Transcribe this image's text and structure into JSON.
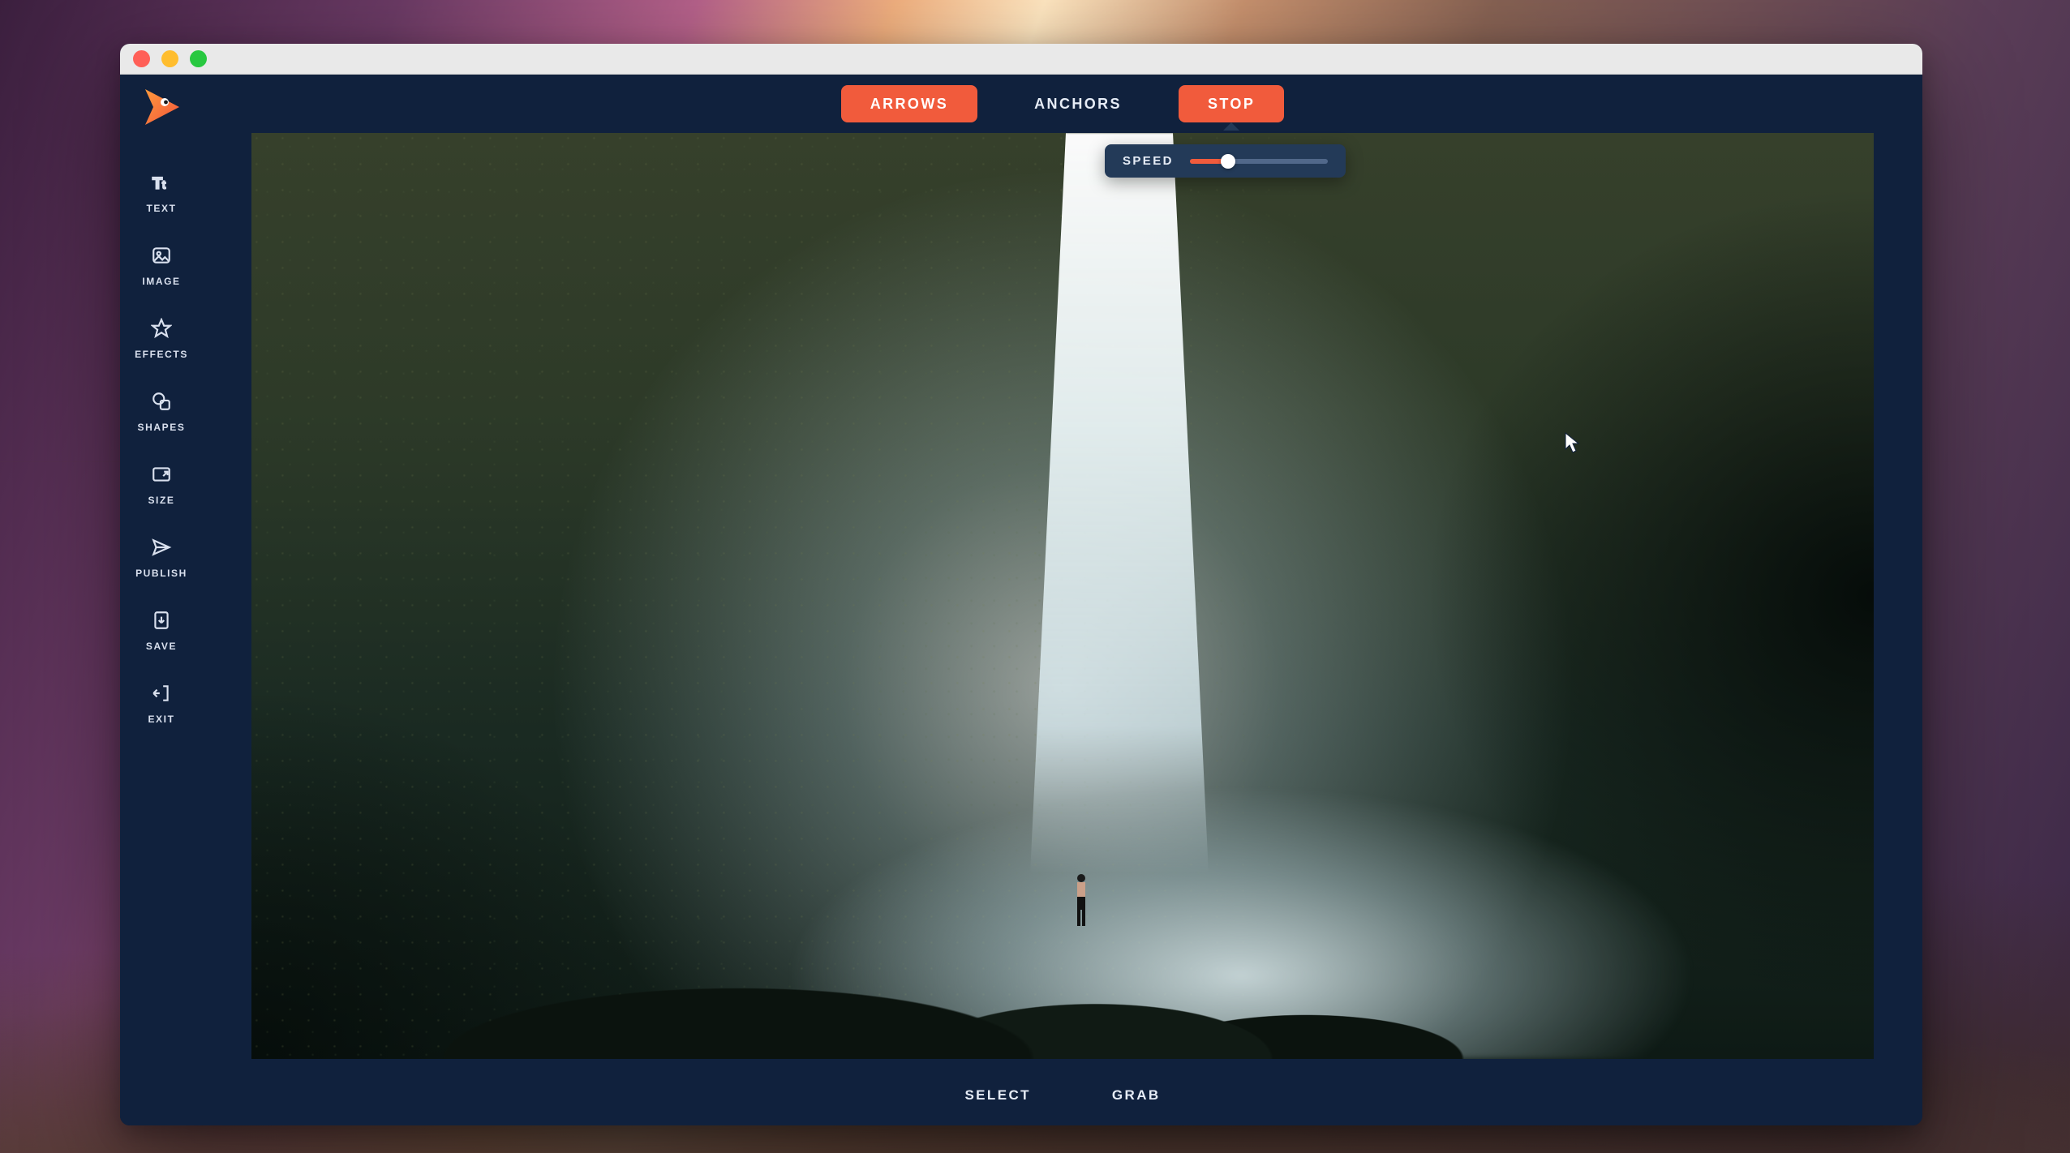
{
  "colors": {
    "accent": "#f15b3c",
    "app_bg": "#10213d",
    "popover_bg": "#233a58",
    "text": "#e6ecf6"
  },
  "sidebar": {
    "items": [
      {
        "id": "text",
        "label": "TEXT"
      },
      {
        "id": "image",
        "label": "IMAGE"
      },
      {
        "id": "effects",
        "label": "EFFECTS"
      },
      {
        "id": "shapes",
        "label": "SHAPES"
      },
      {
        "id": "size",
        "label": "SIZE"
      },
      {
        "id": "publish",
        "label": "PUBLISH"
      },
      {
        "id": "save",
        "label": "SAVE"
      },
      {
        "id": "exit",
        "label": "EXIT"
      }
    ]
  },
  "top_toolbar": {
    "arrows_label": "ARROWS",
    "anchors_label": "ANCHORS",
    "stop_label": "STOP",
    "active": "arrows"
  },
  "speed_control": {
    "label": "SPEED",
    "value_pct": 28
  },
  "bottom_toolbar": {
    "select_label": "SELECT",
    "grab_label": "GRAB"
  }
}
